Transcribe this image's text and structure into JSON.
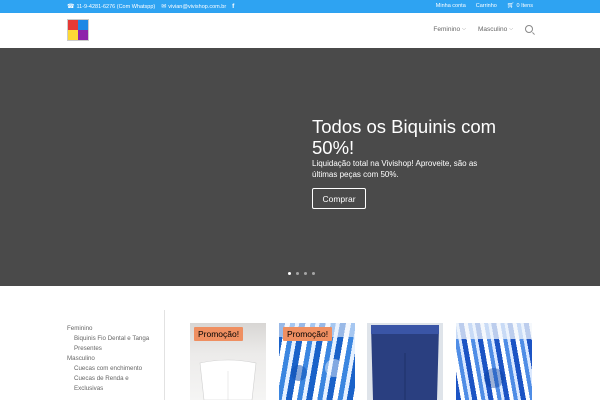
{
  "topbar": {
    "phone": "11-9-4281-6276 (Com Whatspp)",
    "email": "vivian@vivishop.com.br",
    "account": "Minha conta",
    "cart": "Carrinho",
    "items": "0 Itens"
  },
  "nav": {
    "items": [
      "Feminino",
      "Masculino"
    ]
  },
  "hero": {
    "title": "Todos os Biquinis com 50%!",
    "text": "Liquidação total na Vivishop! Aproveite, são as últimas peças com 50%.",
    "button": "Comprar",
    "slides": 4,
    "active_slide": 1
  },
  "sidebar": {
    "items": [
      {
        "label": "Feminino",
        "sub": false
      },
      {
        "label": "Biquinis Fio Dental e Tanga",
        "sub": true
      },
      {
        "label": "Presentes",
        "sub": true
      },
      {
        "label": "Masculino",
        "sub": false
      },
      {
        "label": "Cuecas com enchimento",
        "sub": true
      },
      {
        "label": "Cuecas de Renda e Exclusivas",
        "sub": true
      }
    ]
  },
  "products": [
    {
      "badge": "Promoção!",
      "style": "white"
    },
    {
      "badge": "Promoção!",
      "style": "tiedye"
    },
    {
      "badge": "",
      "style": "navy"
    },
    {
      "badge": "",
      "style": "tiedye2"
    }
  ],
  "colors": {
    "topbar": "#2ea3f2",
    "hero": "#4a4a4a",
    "badge": "#ef8f61"
  }
}
